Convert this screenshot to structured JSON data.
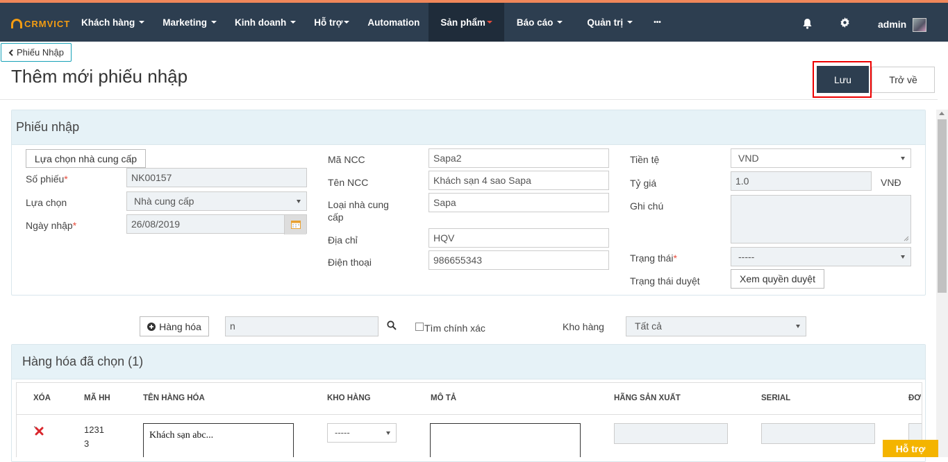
{
  "brand": {
    "logo_text": "CRMVICT"
  },
  "nav": {
    "items": [
      "Khách hàng",
      "Marketing",
      "Kinh doanh",
      "Hỗ trợ",
      "Automation",
      "Sản phẩm",
      "Báo cáo",
      "Quản trị",
      "•••"
    ],
    "user": "admin"
  },
  "breadcrumb": {
    "label": "Phiếu Nhập"
  },
  "page": {
    "title": "Thêm mới phiếu nhập",
    "save": "Lưu",
    "back": "Trở về"
  },
  "form": {
    "panel_title": "Phiếu nhập",
    "choose_supplier": "Lựa chọn nhà cung cấp",
    "so_phieu_label": "Số phiếu",
    "so_phieu": "NK00157",
    "lua_chon_label": "Lựa chọn",
    "lua_chon": "Nhà cung cấp",
    "ngay_nhap_label": "Ngày nhập",
    "ngay_nhap": "26/08/2019",
    "ma_ncc_label": "Mã NCC",
    "ma_ncc": "Sapa2",
    "ten_ncc_label": "Tên NCC",
    "ten_ncc": "Khách sạn 4 sao Sapa",
    "loai_label": "Loại nhà cung cấp",
    "loai": "Sapa",
    "dia_chi_label": "Địa chỉ",
    "dia_chi": "HQV",
    "dien_thoai_label": "Điện thoại",
    "dien_thoai": "986655343",
    "tien_te_label": "Tiền tệ",
    "tien_te": "VND",
    "ty_gia_label": "Tỷ giá",
    "ty_gia": "1.0",
    "ty_gia_unit": "VNĐ",
    "ghi_chu_label": "Ghi chú",
    "trang_thai_label": "Trạng thái",
    "trang_thai": "-----",
    "trang_thai_duyet_label": "Trạng thái duyệt",
    "xem_quyen_duyet": "Xem quyền duyệt"
  },
  "goods_search": {
    "add_button": "Hàng hóa",
    "query": "n",
    "exact_label": "Tìm chính xác",
    "warehouse_label": "Kho hàng",
    "warehouse": "Tất cả"
  },
  "selected": {
    "title": "Hàng hóa đã chọn (1)",
    "columns": [
      "XÓA",
      "MÃ HH",
      "TÊN HÀNG HÓA",
      "KHO HÀNG",
      "MÔ TẢ",
      "HÃNG SẢN XUẤT",
      "SERIAL",
      "ĐƠ"
    ],
    "rows": [
      {
        "code_line1": "1231",
        "code_line2": "3",
        "name": "Khách sạn abc...",
        "warehouse": "-----"
      }
    ]
  },
  "support": {
    "label": "Hỗ trợ"
  }
}
